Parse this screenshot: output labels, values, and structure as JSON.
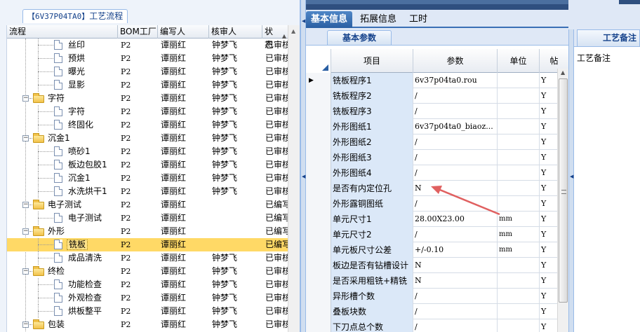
{
  "left_panel": {
    "title_code": "【6V37P04TA0】",
    "title_text": "工艺流程",
    "columns": [
      "流程",
      "BOM工厂",
      "编写人",
      "核审人",
      "状态"
    ],
    "rows": [
      {
        "name": "丝印",
        "type": "doc",
        "bom": "P2",
        "writer": "谭丽红",
        "reviewer": "钟梦飞",
        "status": "已审核"
      },
      {
        "name": "预烘",
        "type": "doc",
        "bom": "P2",
        "writer": "谭丽红",
        "reviewer": "钟梦飞",
        "status": "已审核"
      },
      {
        "name": "曝光",
        "type": "doc",
        "bom": "P2",
        "writer": "谭丽红",
        "reviewer": "钟梦飞",
        "status": "已审核"
      },
      {
        "name": "显影",
        "type": "doc",
        "bom": "P2",
        "writer": "谭丽红",
        "reviewer": "钟梦飞",
        "status": "已审核"
      },
      {
        "name": "字符",
        "type": "folder",
        "bom": "P2",
        "writer": "谭丽红",
        "reviewer": "钟梦飞",
        "status": "已审核"
      },
      {
        "name": "字符",
        "type": "doc",
        "bom": "P2",
        "writer": "谭丽红",
        "reviewer": "钟梦飞",
        "status": "已审核"
      },
      {
        "name": "终固化",
        "type": "doc",
        "bom": "P2",
        "writer": "谭丽红",
        "reviewer": "钟梦飞",
        "status": "已审核"
      },
      {
        "name": "沉金1",
        "type": "folder",
        "bom": "P2",
        "writer": "谭丽红",
        "reviewer": "钟梦飞",
        "status": "已审核"
      },
      {
        "name": "喷砂1",
        "type": "doc",
        "bom": "P2",
        "writer": "谭丽红",
        "reviewer": "钟梦飞",
        "status": "已审核"
      },
      {
        "name": "板边包胶1",
        "type": "doc",
        "bom": "P2",
        "writer": "谭丽红",
        "reviewer": "钟梦飞",
        "status": "已审核"
      },
      {
        "name": "沉金1",
        "type": "doc",
        "bom": "P2",
        "writer": "谭丽红",
        "reviewer": "钟梦飞",
        "status": "已审核"
      },
      {
        "name": "水洗烘干1",
        "type": "doc",
        "bom": "P2",
        "writer": "谭丽红",
        "reviewer": "钟梦飞",
        "status": "已审核"
      },
      {
        "name": "电子测试",
        "type": "folder",
        "bom": "P2",
        "writer": "谭丽红",
        "reviewer": "",
        "status": "已编写"
      },
      {
        "name": "电子测试",
        "type": "doc",
        "bom": "P2",
        "writer": "谭丽红",
        "reviewer": "",
        "status": "已编写"
      },
      {
        "name": "外形",
        "type": "folder",
        "bom": "P2",
        "writer": "谭丽红",
        "reviewer": "",
        "status": "已编写"
      },
      {
        "name": "铣板",
        "type": "doc",
        "bom": "P2",
        "writer": "谭丽红",
        "reviewer": "",
        "status": "已编写",
        "selected": true
      },
      {
        "name": "成品清洗",
        "type": "doc",
        "bom": "P2",
        "writer": "谭丽红",
        "reviewer": "钟梦飞",
        "status": "已审核"
      },
      {
        "name": "终检",
        "type": "folder",
        "bom": "P2",
        "writer": "谭丽红",
        "reviewer": "钟梦飞",
        "status": "已审核"
      },
      {
        "name": "功能检查",
        "type": "doc",
        "bom": "P2",
        "writer": "谭丽红",
        "reviewer": "钟梦飞",
        "status": "已审核"
      },
      {
        "name": "外观检查",
        "type": "doc",
        "bom": "P2",
        "writer": "谭丽红",
        "reviewer": "钟梦飞",
        "status": "已审核"
      },
      {
        "name": "烘板整平",
        "type": "doc",
        "bom": "P2",
        "writer": "谭丽红",
        "reviewer": "钟梦飞",
        "status": "已审核"
      },
      {
        "name": "包装",
        "type": "folder",
        "bom": "P2",
        "writer": "谭丽红",
        "reviewer": "钟梦飞",
        "status": "已审核"
      }
    ]
  },
  "mid_panel": {
    "tabs": [
      "基本信息",
      "拓展信息",
      "工时"
    ],
    "active_tab": "基本信息",
    "sub_tab": "基本参数",
    "columns": [
      "项目",
      "参数",
      "单位",
      "帖"
    ],
    "rows": [
      {
        "item": "铣板程序1",
        "param": "6v37p04ta0.rou",
        "unit": "",
        "flag": "Y",
        "current": true
      },
      {
        "item": "铣板程序2",
        "param": "/",
        "unit": "",
        "flag": "Y"
      },
      {
        "item": "铣板程序3",
        "param": "/",
        "unit": "",
        "flag": "Y"
      },
      {
        "item": "外形图纸1",
        "param": "6v37p04ta0_biaoz...",
        "unit": "",
        "flag": "Y"
      },
      {
        "item": "外形图纸2",
        "param": "/",
        "unit": "",
        "flag": "Y"
      },
      {
        "item": "外形图纸3",
        "param": "/",
        "unit": "",
        "flag": "Y"
      },
      {
        "item": "外形图纸4",
        "param": "/",
        "unit": "",
        "flag": "Y"
      },
      {
        "item": "是否有内定位孔",
        "param": "N",
        "unit": "",
        "flag": "Y"
      },
      {
        "item": "外形露铜图纸",
        "param": "/",
        "unit": "",
        "flag": "Y"
      },
      {
        "item": "单元尺寸1",
        "param": "28.00X23.00",
        "unit": "mm",
        "flag": "Y"
      },
      {
        "item": "单元尺寸2",
        "param": "/",
        "unit": "mm",
        "flag": "Y"
      },
      {
        "item": "单元板尺寸公差",
        "param": "+/-0.10",
        "unit": "mm",
        "flag": "Y"
      },
      {
        "item": "板边是否有钻槽设计",
        "param": "N",
        "unit": "",
        "flag": "Y"
      },
      {
        "item": "是否采用粗铣+精铣",
        "param": "N",
        "unit": "",
        "flag": "Y"
      },
      {
        "item": "异形槽个数",
        "param": "/",
        "unit": "",
        "flag": "Y"
      },
      {
        "item": "叠板块数",
        "param": "/",
        "unit": "",
        "flag": "Y"
      },
      {
        "item": "下刀点总个数",
        "param": "/",
        "unit": "",
        "flag": "Y"
      }
    ]
  },
  "right_panel": {
    "tab": "工艺备注",
    "label": "工艺备注"
  },
  "icons": {
    "doc": "document-icon",
    "folder": "folder-icon",
    "annotation": "red-arrow-annotation"
  },
  "colors": {
    "selected_row": "#ffd966",
    "active_tab": "#2a5fa3",
    "item_cell": "#dbe8f8",
    "annotation": "#e06060"
  }
}
